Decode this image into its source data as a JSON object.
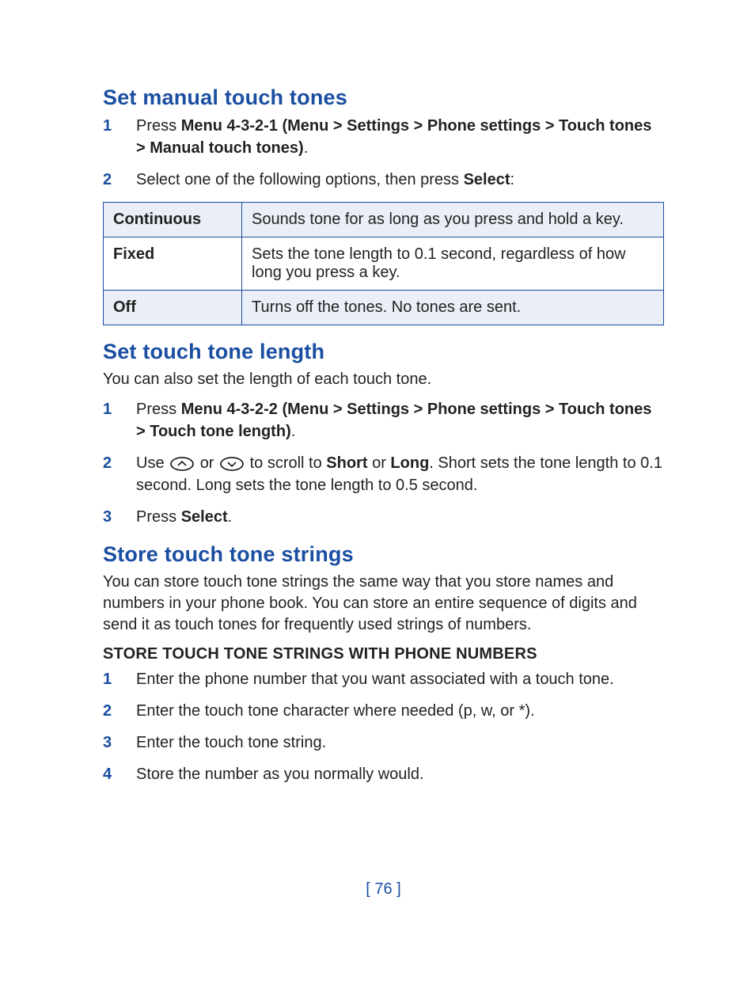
{
  "section1": {
    "heading": "Set manual touch tones",
    "step1_pre": "Press ",
    "step1_bold": "Menu 4-3-2-1 (Menu > Settings > Phone settings > Touch tones > Manual touch tones)",
    "step1_post": ".",
    "step2_pre": "Select one of the following options, then press ",
    "step2_bold": "Select",
    "step2_post": ":",
    "table": {
      "r1k": "Continuous",
      "r1v": "Sounds tone for as long as you press and hold a key.",
      "r2k": "Fixed",
      "r2v": "Sets the tone length to 0.1 second, regardless of how long you press a key.",
      "r3k": "Off",
      "r3v": "Turns off the tones. No tones are sent."
    }
  },
  "section2": {
    "heading": "Set touch tone length",
    "intro": "You can also set the length of each touch tone.",
    "step1_pre": "Press ",
    "step1_bold": "Menu 4-3-2-2 (Menu > Settings > Phone settings > Touch tones > Touch tone length)",
    "step1_post": ".",
    "step2_a": "Use ",
    "step2_b": " or ",
    "step2_c": " to scroll to ",
    "step2_short": "Short",
    "step2_d": " or ",
    "step2_long": "Long",
    "step2_e": ". Short sets the tone length to 0.1 second. Long sets the tone length to 0.5 second.",
    "step3_pre": "Press ",
    "step3_bold": "Select",
    "step3_post": "."
  },
  "section3": {
    "heading": "Store touch tone strings",
    "intro": "You can store touch tone strings the same way that you store names and numbers in your phone book. You can store an entire sequence of digits and send it as touch tones for frequently used strings of numbers.",
    "subhead": "STORE TOUCH TONE STRINGS WITH PHONE NUMBERS",
    "s1": "Enter the phone number that you want associated with a touch tone.",
    "s2": "Enter the touch tone character where needed (p, w, or *).",
    "s3": "Enter the touch tone string.",
    "s4": "Store the number as you normally would."
  },
  "nums": {
    "n1": "1",
    "n2": "2",
    "n3": "3",
    "n4": "4"
  },
  "footer": "[ 76 ]"
}
